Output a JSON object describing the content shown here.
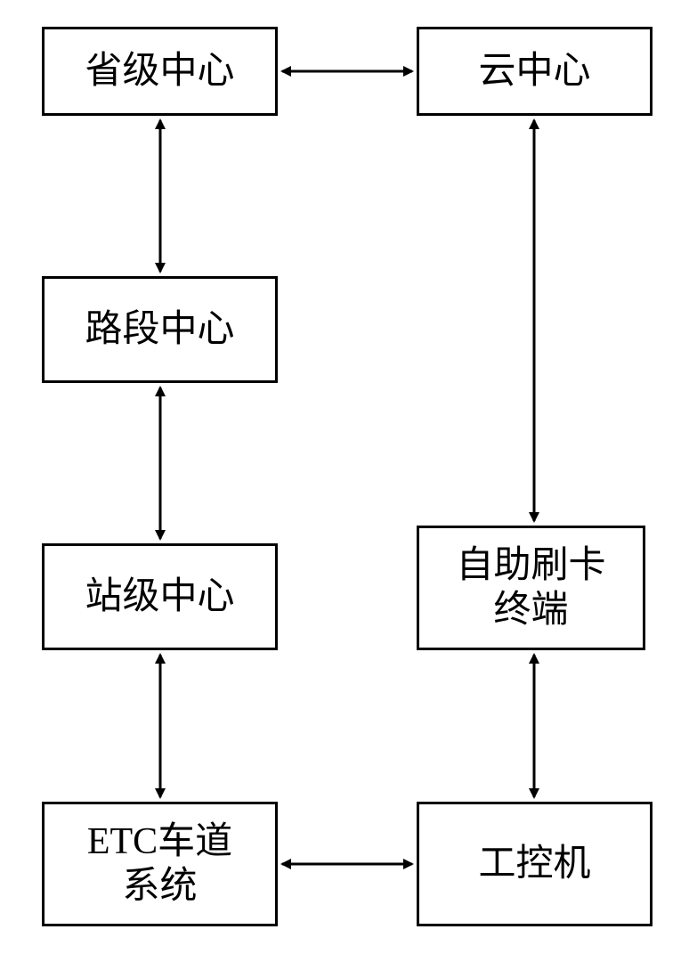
{
  "boxes": {
    "provincial_center": "省级中心",
    "cloud_center": "云中心",
    "section_center": "路段中心",
    "station_center": "站级中心",
    "self_service_terminal": "自助刷卡\n终端",
    "etc_lane_system": "ETC车道\n系统",
    "industrial_pc": "工控机"
  }
}
